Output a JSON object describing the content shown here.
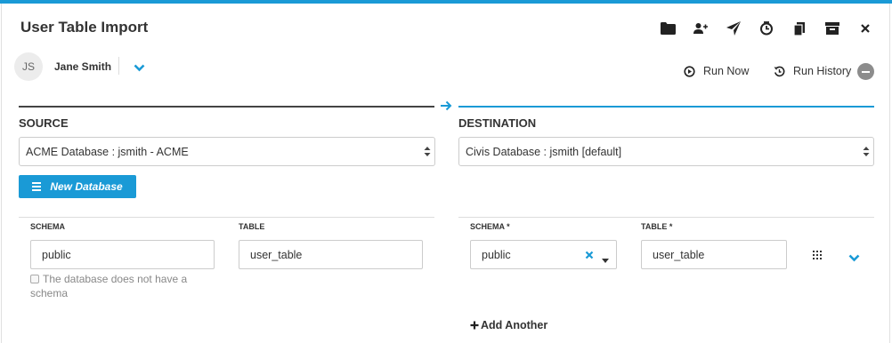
{
  "header": {
    "title": "User Table Import"
  },
  "toolbar": {
    "icons": [
      "folder-icon",
      "share-user-icon",
      "send-icon",
      "schedule-icon",
      "clone-icon",
      "archive-icon",
      "close-icon"
    ]
  },
  "user": {
    "initials": "JS",
    "name": "Jane Smith"
  },
  "actions": {
    "run_now": "Run Now",
    "run_history": "Run History"
  },
  "source": {
    "label": "SOURCE",
    "database": "ACME Database : jsmith - ACME",
    "new_database": "New Database",
    "schema_label": "SCHEMA",
    "schema_value": "public",
    "table_label": "TABLE",
    "table_value": "user_table",
    "no_schema_text": "The database does not have a schema"
  },
  "destination": {
    "label": "DESTINATION",
    "database": "Civis Database : jsmith [default]",
    "schema_label": "SCHEMA *",
    "schema_value": "public",
    "table_label": "TABLE *",
    "table_value": "user_table",
    "add_another": "Add Another"
  },
  "colors": {
    "accent": "#1a9ad6",
    "text": "#333333",
    "border": "#cccccc"
  }
}
